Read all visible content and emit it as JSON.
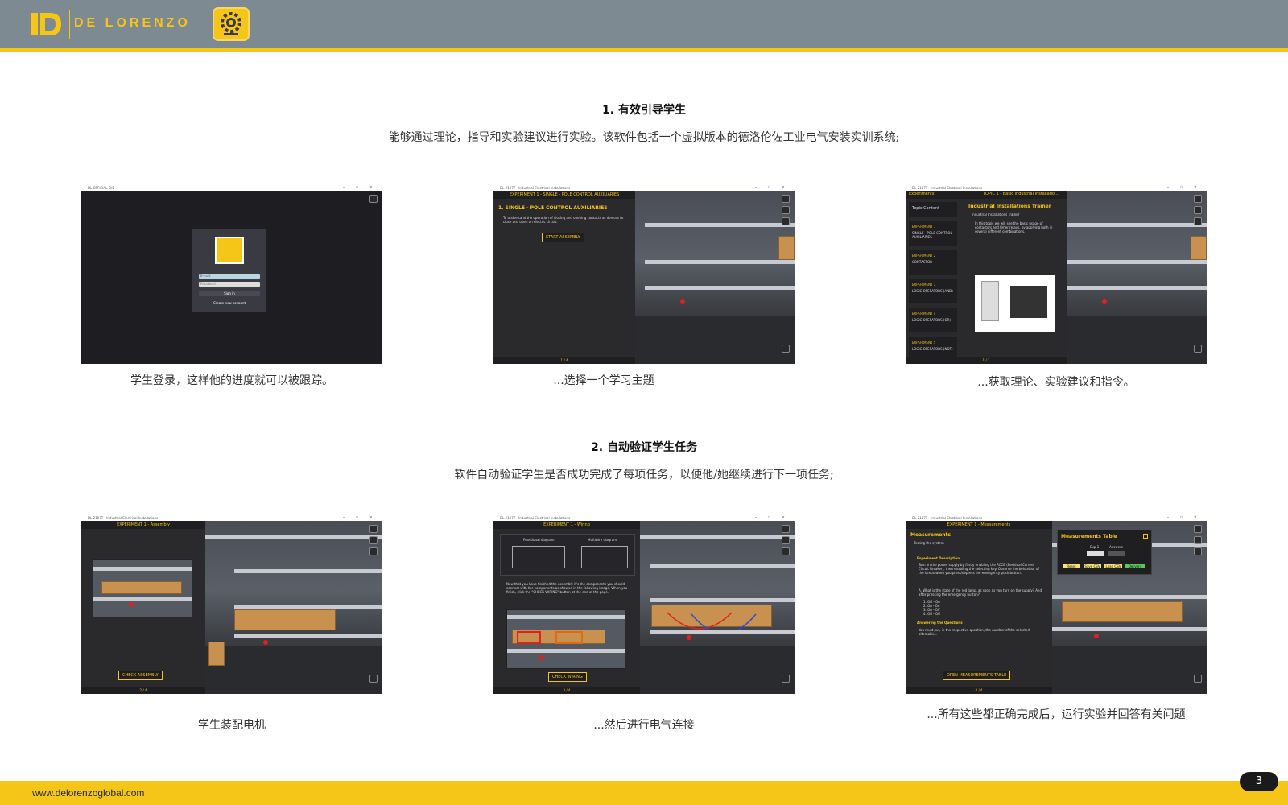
{
  "header": {
    "brand_name": "DE LORENZO",
    "colors": {
      "bar": "#7d8a92",
      "accent": "#f5c518"
    },
    "logo_icon": "dl-logo-icon",
    "badge_icon": "gear-monitor-icon"
  },
  "section1": {
    "title": "1. 有效引导学生",
    "description": "能够通过理论，指导和实验建议进行实验。该软件包括一个虚拟版本的德洛伦佐工业电气安装实训系统;",
    "items": [
      {
        "caption": "学生登录，这样他的进度就可以被跟踪。",
        "shot": {
          "window_title": "DL OFFICIAL EIIE",
          "login_email": "E-mail",
          "login_password": "Password",
          "login_button": "Sign in",
          "login_link": "Create new account"
        }
      },
      {
        "caption": "...选择一个学习主题",
        "shot": {
          "window_title": "DL 2107T - Industrial Electrical Installations",
          "panel_header": "EXPERIMENT 1 - SINGLE - POLE CONTROL AUXILIARIES",
          "heading": "1. SINGLE - POLE CONTROL AUXILIARIES",
          "body": "To understand the operation of closing and opening contacts as devices to close and open an electric circuit.",
          "button": "START ASSEMBLY",
          "page": "1 / 4"
        }
      },
      {
        "caption": "...获取理论、实验建议和指令。",
        "shot": {
          "window_title": "DL 2107T - Industrial Electrical Installations",
          "back_label": "Experiments",
          "panel_header": "TOPIC 1 - Basic Industrial Installatio...",
          "topic_content": "Topic Content",
          "heading": "Industrial Installations Trainer",
          "subheading": "Industrial Installations Trainer",
          "body": "In this topic we will see the basic usage of contactors and timer relays, by applying both in several different combinations.",
          "experiments": [
            {
              "title": "EXPERIMENT 1",
              "subtitle": "SINGLE - POLE CONTROL AUXILIARIES"
            },
            {
              "title": "EXPERIMENT 2",
              "subtitle": "CONTACTOR"
            },
            {
              "title": "EXPERIMENT 3",
              "subtitle": "LOGIC OPERATORS (AND)"
            },
            {
              "title": "EXPERIMENT 4",
              "subtitle": "LOGIC OPERATORS (OR)"
            },
            {
              "title": "EXPERIMENT 5",
              "subtitle": "LOGIC OPERATORS (NOT)"
            }
          ],
          "page": "1 / 1"
        }
      }
    ]
  },
  "section2": {
    "title": "2. 自动验证学生任务",
    "description": "软件自动验证学生是否成功完成了每项任务，以便他/她继续进行下一项任务;",
    "items": [
      {
        "caption": "学生装配电机",
        "shot": {
          "window_title": "DL 2107T - Industrial Electrical Installations",
          "panel_header": "EXPERIMENT 1 - Assembly",
          "button": "CHECK ASSEMBLY",
          "page": "2 / 4"
        }
      },
      {
        "caption": "...然后进行电气连接",
        "shot": {
          "window_title": "DL 2107T - Industrial Electrical Installations",
          "panel_header": "EXPERIMENT 1 - Wiring",
          "diagram_left": "Functional diagram",
          "diagram_right": "Multiwire diagram",
          "body": "Now that you have finished the assembly it's the components you should connect with the components as showed in the following image. When you finish, click the \"CHECK WIRING\" button at the end of the page.",
          "button": "CHECK WIRING",
          "page": "3 / 4"
        }
      },
      {
        "caption": "...所有这些都正确完成后，运行实验并回答有关问题",
        "shot": {
          "window_title": "DL 2107T - Industrial Electrical Installations",
          "panel_header": "EXPERIMENT 1 - Measurements",
          "heading": "Measurements",
          "subheading": "Testing the system",
          "exp_desc_title": "Experiment Description",
          "exp_desc": "Turn on the power supply by firstly enabling the RCCB (Residual Current Circuit Breaker), then enabling the selecting key. Observe the behaviour of the lamps when you press/depress the emergency push button.",
          "question": "A. What is the state of the red lamp, as soon as you turn on the supply? And after pressing the emergency button?",
          "answers": [
            "1. Off - On",
            "2. On - On",
            "3. On - Off",
            "4. Off - Off"
          ],
          "answering_title": "Answering the Questions",
          "answering_text": "You must put, in the respective question, the number of the selected alternative.",
          "button": "OPEN MEASUREMENTS TABLE",
          "page": "4 / 4",
          "modal_title": "Measurements Table",
          "modal_col1": "Exp 1",
          "modal_col2": "Answers",
          "modal_buttons": [
            "Reset",
            "Save CSV",
            "Load CSV",
            "Delivery"
          ]
        }
      }
    ]
  },
  "footer": {
    "url": "www.delorenzoglobal.com",
    "page_number": "3"
  }
}
